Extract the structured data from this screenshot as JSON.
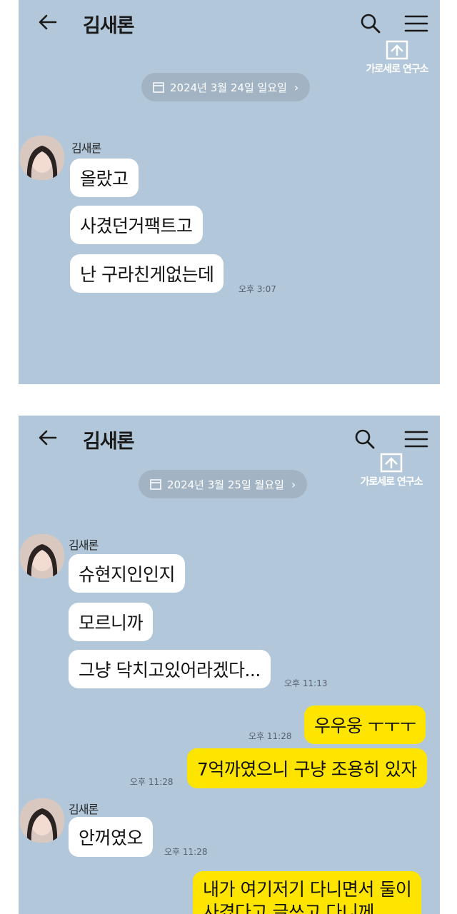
{
  "screens": [
    {
      "title": "김새론",
      "date": "2024년 3월 24일 일요일",
      "watermark": "가로세로 연구소",
      "sender": "김새론",
      "messages": [
        {
          "text": "올랐고"
        },
        {
          "text": "사겼던거팩트고"
        },
        {
          "text": "난 구라친게없는데",
          "time": "오후 3:07"
        }
      ]
    },
    {
      "title": "김새론",
      "date": "2024년 3월 25일 월요일",
      "watermark": "가로세로 연구소",
      "group1": {
        "sender": "김새론",
        "messages": [
          {
            "text": "슈현지인인지"
          },
          {
            "text": "모르니까"
          },
          {
            "text": "그냥 닥치고있어라겠다...",
            "time": "오후 11:13"
          }
        ]
      },
      "outgoing1": {
        "text": "우우웅 ㅜㅜㅜ",
        "time": "오후 11:28"
      },
      "outgoing2": {
        "text": "7억까였으니 구냥 조용히 있자",
        "time": "오후 11:28"
      },
      "group2": {
        "sender": "김새론",
        "messages": [
          {
            "text": "안꺼였오",
            "time": "오후 11:28"
          }
        ]
      },
      "outgoing3": {
        "line1": "내가 여기저기 다니면서 둘이",
        "line2": "사겼다고 글쓰고 다니께"
      }
    }
  ],
  "colors": {
    "chat_bg": "#b2c7d9",
    "incoming_bubble": "#ffffff",
    "outgoing_bubble": "#fee500",
    "date_pill": "#a2b4c4"
  },
  "icons": [
    "back-arrow-icon",
    "search-icon",
    "menu-icon",
    "calendar-icon",
    "chevron-right-icon",
    "watermark-logo-icon",
    "avatar"
  ]
}
